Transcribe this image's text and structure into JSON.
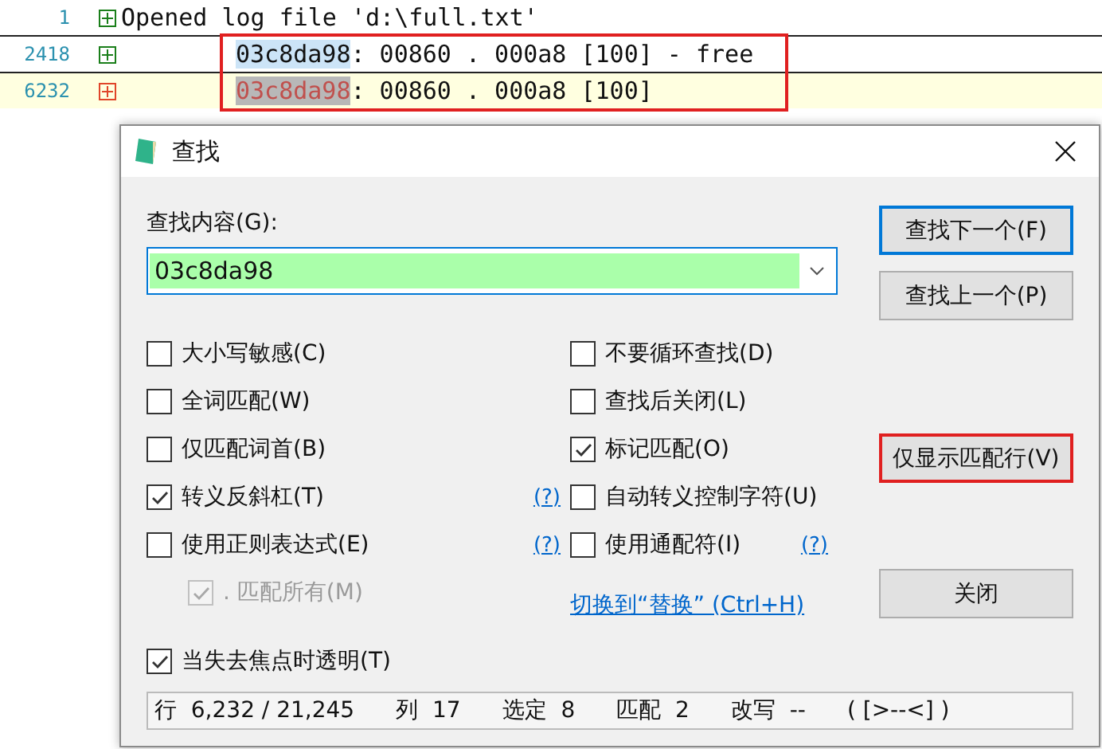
{
  "editor": {
    "lines": [
      {
        "number": "1",
        "color": "#1a7f1a",
        "current": false,
        "text": "Opened log file 'd:\\full.txt'"
      },
      {
        "number": "2418",
        "color": "#1a7f1a",
        "current": false,
        "match": "03c8da98",
        "text": ": 00860 . 000a8 [100] - free"
      },
      {
        "number": "6232",
        "color": "#e0452a",
        "current": true,
        "match": "03c8da98",
        "text": ": 00860 . 000a8 [100]"
      }
    ],
    "frame": true
  },
  "dialog": {
    "title": "查找",
    "find_label": "查找内容(G):",
    "find_value": "03c8da98",
    "options_left": [
      {
        "label": "大小写敏感(C)",
        "checked": false,
        "disabled": false
      },
      {
        "label": "全词匹配(W)",
        "checked": false,
        "disabled": false
      },
      {
        "label": "仅匹配词首(B)",
        "checked": false,
        "disabled": false
      },
      {
        "label": "转义反斜杠(T)",
        "checked": true,
        "disabled": false,
        "help": "(?)"
      },
      {
        "label": "使用正则表达式(E)",
        "checked": false,
        "disabled": false,
        "help": "(?)"
      },
      {
        "label": ". 匹配所有(M)",
        "checked": true,
        "disabled": true
      }
    ],
    "options_right": [
      {
        "label": "不要循环查找(D)",
        "checked": false,
        "disabled": false
      },
      {
        "label": "查找后关闭(L)",
        "checked": false,
        "disabled": false
      },
      {
        "label": "标记匹配(O)",
        "checked": true,
        "disabled": false
      },
      {
        "label": "自动转义控制字符(U)",
        "checked": false,
        "disabled": false
      },
      {
        "label": "使用通配符(I)",
        "checked": false,
        "disabled": false,
        "help": "(?)"
      }
    ],
    "link": "切换到“替换” (Ctrl+H)",
    "transparent": {
      "label": "当失去焦点时透明(T)",
      "checked": true
    },
    "buttons": [
      {
        "label": "查找下一个(F)",
        "default": true,
        "highlighted": false
      },
      {
        "label": "查找上一个(P)",
        "default": false,
        "highlighted": false
      },
      {
        "label": "仅显示匹配行(V)",
        "default": false,
        "highlighted": true
      },
      {
        "label": "关闭",
        "default": false,
        "highlighted": false
      }
    ],
    "status": [
      {
        "label": "行",
        "value": "6,232 / 21,245"
      },
      {
        "label": "列",
        "value": "17"
      },
      {
        "label": "选定",
        "value": "8"
      },
      {
        "label": "匹配",
        "value": "2"
      },
      {
        "label": "改写",
        "value": "--"
      }
    ],
    "status_tail": "( [>--<] )"
  }
}
